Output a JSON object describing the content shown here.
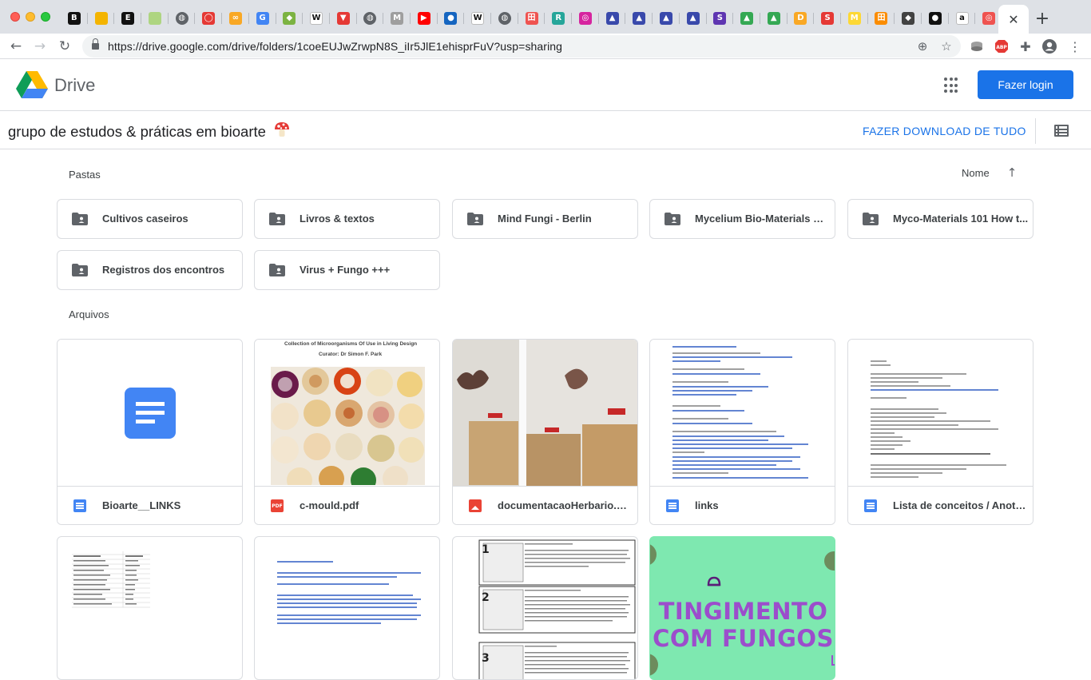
{
  "browser": {
    "url": "https://drive.google.com/drive/folders/1coeEUJwZrwpN8S_iIr5JlE1ehisprFuV?usp=sharing",
    "tabs": [
      {
        "icon": "b-icon",
        "color": "#111111",
        "glyph": "B"
      },
      {
        "icon": "slides-icon",
        "color": "#f4b400",
        "glyph": ""
      },
      {
        "icon": "e-icon",
        "color": "#111111",
        "glyph": "E"
      },
      {
        "icon": "sheet-icon",
        "color": "#aed581",
        "glyph": ""
      },
      {
        "icon": "globe-icon",
        "color": "#5f6368",
        "glyph": "◍"
      },
      {
        "icon": "drop-icon",
        "color": "#e53935",
        "glyph": "◯"
      },
      {
        "icon": "infinity-icon",
        "color": "#f9a825",
        "glyph": "∞"
      },
      {
        "icon": "google-icon",
        "color": "#4285f4",
        "glyph": "G"
      },
      {
        "icon": "leaf-icon",
        "color": "#7cb342",
        "glyph": "◆"
      },
      {
        "icon": "wikipedia-icon",
        "color": "#ffffff",
        "glyph": "W"
      },
      {
        "icon": "bookmark-icon",
        "color": "#e53935",
        "glyph": "▼"
      },
      {
        "icon": "globe-icon",
        "color": "#5f6368",
        "glyph": "◍"
      },
      {
        "icon": "m-icon",
        "color": "#9e9e9e",
        "glyph": "M"
      },
      {
        "icon": "youtube-icon",
        "color": "#ff0000",
        "glyph": "▶"
      },
      {
        "icon": "circle-icon",
        "color": "#1565c0",
        "glyph": "●"
      },
      {
        "icon": "wikipedia-icon",
        "color": "#ffffff",
        "glyph": "W"
      },
      {
        "icon": "globe-icon",
        "color": "#5f6368",
        "glyph": "◍"
      },
      {
        "icon": "grid-icon",
        "color": "#ef5350",
        "glyph": "田"
      },
      {
        "icon": "r-icon",
        "color": "#26a69a",
        "glyph": "R"
      },
      {
        "icon": "instagram-icon",
        "color": "#d6249f",
        "glyph": "◎"
      },
      {
        "icon": "bird-icon",
        "color": "#3949ab",
        "glyph": "▲"
      },
      {
        "icon": "bird-icon",
        "color": "#3949ab",
        "glyph": "▲"
      },
      {
        "icon": "bird-icon",
        "color": "#3949ab",
        "glyph": "▲"
      },
      {
        "icon": "bird-icon",
        "color": "#3949ab",
        "glyph": "▲"
      },
      {
        "icon": "s-icon",
        "color": "#5e35b1",
        "glyph": "S"
      },
      {
        "icon": "drive-icon",
        "color": "#34a853",
        "glyph": "▲"
      },
      {
        "icon": "drive-icon",
        "color": "#34a853",
        "glyph": "▲"
      },
      {
        "icon": "d-icon",
        "color": "#f9a825",
        "glyph": "D"
      },
      {
        "icon": "s-red-icon",
        "color": "#e53935",
        "glyph": "S"
      },
      {
        "icon": "m-yellow-icon",
        "color": "#fdd835",
        "glyph": "M"
      },
      {
        "icon": "grid-orange-icon",
        "color": "#fb8c00",
        "glyph": "田"
      },
      {
        "icon": "diamond-icon",
        "color": "#424242",
        "glyph": "◆"
      },
      {
        "icon": "black-circle-icon",
        "color": "#111111",
        "glyph": "●"
      },
      {
        "icon": "amazon-icon",
        "color": "#ffffff",
        "glyph": "a"
      },
      {
        "icon": "target-icon",
        "color": "#ef5350",
        "glyph": "◎"
      }
    ]
  },
  "drive": {
    "app_name": "Drive",
    "login_label": "Fazer login",
    "folder_title": "grupo de estudos & práticas em bioarte",
    "download_all": "FAZER DOWNLOAD DE TUDO",
    "folders_section": "Pastas",
    "files_section": "Arquivos",
    "sort_label": "Nome",
    "folders": [
      "Cultivos caseiros",
      "Livros & textos",
      "Mind Fungi - Berlin",
      "Mycelium Bio-Materials W...",
      "Myco-Materials 101 How t...",
      "Registros dos encontros",
      "Virus + Fungo +++"
    ],
    "files": [
      {
        "name": "Bioarte__LINKS",
        "type": "doc"
      },
      {
        "name": "c-mould.pdf",
        "type": "pdf"
      },
      {
        "name": "documentacaoHerbario.png",
        "type": "image"
      },
      {
        "name": "links",
        "type": "doc"
      },
      {
        "name": "Lista de conceitos / Anota...",
        "type": "doc"
      }
    ],
    "thumb_text": {
      "cmould_title": "Collection of Microorganisms Of Use in Living Design",
      "cmould_curator": "Curator: Dr Simon F. Park",
      "tingimento_line1": "TINGIMENTO",
      "tingimento_line2": "COM FUNGOS"
    }
  },
  "colors": {
    "accent": "#1a73e8",
    "card_border": "#dadce0",
    "tingimento_bg": "#7ee8b0",
    "tingimento_text": "#9c4dcc"
  }
}
